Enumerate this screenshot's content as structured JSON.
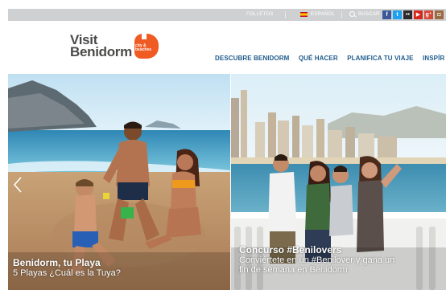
{
  "topbar": {
    "folletos": "FOLLETOS",
    "language": "ESPAÑOL",
    "buscar": "BUSCAR",
    "social": [
      {
        "icon": "facebook-icon",
        "glyph": "f",
        "color": "#3b5998"
      },
      {
        "icon": "twitter-icon",
        "glyph": "t",
        "color": "#1da1f2"
      },
      {
        "icon": "flickr-icon",
        "glyph": "••",
        "color": "#2c2c2c"
      },
      {
        "icon": "youtube-icon",
        "glyph": "▶",
        "color": "#d7261e"
      },
      {
        "icon": "google-plus-icon",
        "glyph": "g⁺",
        "color": "#d34836"
      },
      {
        "icon": "instagram-icon",
        "glyph": "◘",
        "color": "#9b6b43"
      }
    ]
  },
  "logo": {
    "line1": "Visit",
    "line2": "Benidorm",
    "mark_text": "city & beaches",
    "mark_color": "#f05a23"
  },
  "nav": {
    "items": [
      "DESCUBRE BENIDORM",
      "QUÉ HACER",
      "PLANIFICA TU VIAJE",
      "INSPÍR"
    ]
  },
  "slides": [
    {
      "title": "Benidorm, tu Playa",
      "subtitle": "5 Playas ¿Cuál es la Tuya?"
    },
    {
      "title": "Concurso #Benilovers",
      "subtitle_line1": "Conviértete en un #Benilover y gana un",
      "subtitle_line2": "fin de semana en Benidorm"
    }
  ],
  "colors": {
    "topbar_bg": "#cfd0d2",
    "nav_text": "#1f5b8c",
    "logo_text": "#4a4a49"
  }
}
